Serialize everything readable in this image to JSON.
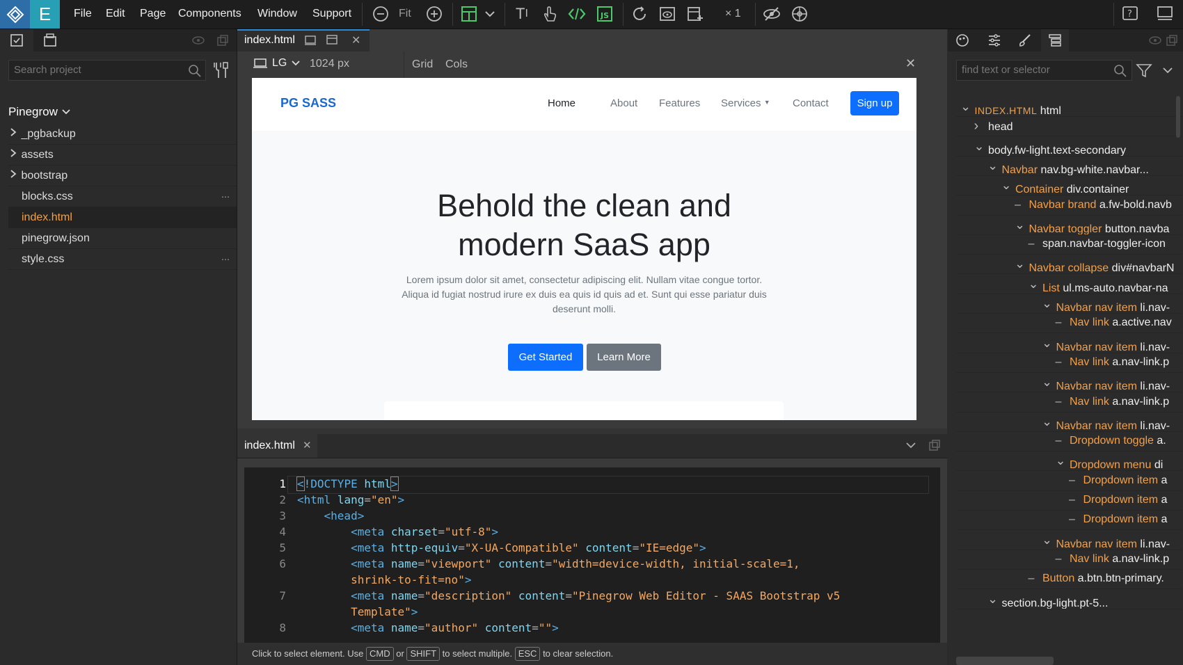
{
  "app": {
    "menu": [
      "File",
      "Edit",
      "Page",
      "Components",
      "Window",
      "Support"
    ],
    "zoom_label": "Fit",
    "multiplier": "× 1"
  },
  "left": {
    "search_placeholder": "Search project",
    "project_name": "Pinegrow",
    "items": [
      {
        "label": "_pgbackup",
        "folder": true
      },
      {
        "label": "assets",
        "folder": true
      },
      {
        "label": "bootstrap",
        "folder": true
      },
      {
        "label": "blocks.css",
        "folder": false,
        "more": true
      },
      {
        "label": "index.html",
        "folder": false,
        "active": true
      },
      {
        "label": "pinegrow.json",
        "folder": false
      },
      {
        "label": "style.css",
        "folder": false,
        "more": true
      }
    ]
  },
  "center": {
    "doc_tab": "index.html",
    "device": "LG",
    "width_label": "1024 px",
    "grid_label": "Grid",
    "cols_label": "Cols",
    "site": {
      "brand": "PG SASS",
      "nav": [
        "Home",
        "About",
        "Features",
        "Services",
        "Contact"
      ],
      "signup": "Sign up",
      "headline_1": "Behold the clean and",
      "headline_2": "modern SaaS app",
      "lead_1": "Lorem ipsum dolor sit amet, consectetur adipiscing elit. Nullam vitae congue tortor.",
      "lead_2": "Aliqua id fugiat nostrud irure ex duis ea quis id quis ad et. Sunt qui esse pariatur duis",
      "lead_3": "deserunt molli.",
      "btn_primary": "Get Started",
      "btn_secondary": "Learn More"
    },
    "code_tab": "index.html",
    "code_line_numbers": [
      "1",
      "2",
      "3",
      "4",
      "5",
      "6",
      "",
      "7",
      "",
      "8"
    ],
    "status": {
      "t1": "Click to select element. Use",
      "k1": "CMD",
      "t2": "or",
      "k2": "SHIFT",
      "t3": "to select multiple.",
      "k3": "ESC",
      "t4": "to clear selection."
    }
  },
  "right": {
    "search_placeholder": "find text or selector",
    "tree": [
      {
        "d": 0,
        "caret": "down",
        "comp": "INDEX.HTML",
        "sel": "html"
      },
      {
        "d": 1,
        "caret": "right",
        "comp": "",
        "sel": "head"
      },
      {
        "d": 1,
        "caret": "down",
        "comp": "",
        "sel": "body.fw-light.text-secondary"
      },
      {
        "d": 2,
        "caret": "down",
        "comp": "Navbar",
        "sel": "nav.bg-white.navbar..."
      },
      {
        "d": 3,
        "caret": "down",
        "comp": "Container",
        "sel": "div.container"
      },
      {
        "d": 4,
        "caret": "dash",
        "comp": "Navbar brand",
        "sel": "a.fw-bold.navb"
      },
      {
        "d": 4,
        "caret": "down",
        "comp": "Navbar toggler",
        "sel": "button.navba"
      },
      {
        "d": 5,
        "caret": "dash",
        "comp": "",
        "sel": "span.navbar-toggler-icon"
      },
      {
        "d": 4,
        "caret": "down",
        "comp": "Navbar collapse",
        "sel": "div#navbarN"
      },
      {
        "d": 5,
        "caret": "down",
        "comp": "List",
        "sel": "ul.ms-auto.navbar-na"
      },
      {
        "d": 6,
        "caret": "down",
        "comp": "Navbar nav item",
        "sel": "li.nav-"
      },
      {
        "d": 7,
        "caret": "dash",
        "comp": "Nav link",
        "sel": "a.active.nav"
      },
      {
        "d": 6,
        "caret": "down",
        "comp": "Navbar nav item",
        "sel": "li.nav-"
      },
      {
        "d": 7,
        "caret": "dash",
        "comp": "Nav link",
        "sel": "a.nav-link.p"
      },
      {
        "d": 6,
        "caret": "down",
        "comp": "Navbar nav item",
        "sel": "li.nav-"
      },
      {
        "d": 7,
        "caret": "dash",
        "comp": "Nav link",
        "sel": "a.nav-link.p"
      },
      {
        "d": 6,
        "caret": "down",
        "comp": "Navbar nav item",
        "sel": "li.nav-"
      },
      {
        "d": 7,
        "caret": "dash",
        "comp": "Dropdown toggle",
        "sel": "a."
      },
      {
        "d": 7,
        "caret": "down",
        "comp": "Dropdown menu",
        "sel": "di"
      },
      {
        "d": 8,
        "caret": "dash",
        "comp": "Dropdown item",
        "sel": "a"
      },
      {
        "d": 8,
        "caret": "dash",
        "comp": "Dropdown item",
        "sel": "a"
      },
      {
        "d": 8,
        "caret": "dash",
        "comp": "Dropdown item",
        "sel": "a"
      },
      {
        "d": 6,
        "caret": "down",
        "comp": "Navbar nav item",
        "sel": "li.nav-"
      },
      {
        "d": 7,
        "caret": "dash",
        "comp": "Nav link",
        "sel": "a.nav-link.p"
      },
      {
        "d": 5,
        "caret": "dash",
        "comp": "Button",
        "sel": "a.btn.btn-primary."
      },
      {
        "d": 2,
        "caret": "down",
        "comp": "",
        "sel": "section.bg-light.pt-5..."
      }
    ]
  },
  "colors": {
    "accent": "#2d8ad8",
    "component": "#f3a04a",
    "primary_btn": "#0d6efd",
    "secondary_btn": "#6c757d"
  }
}
